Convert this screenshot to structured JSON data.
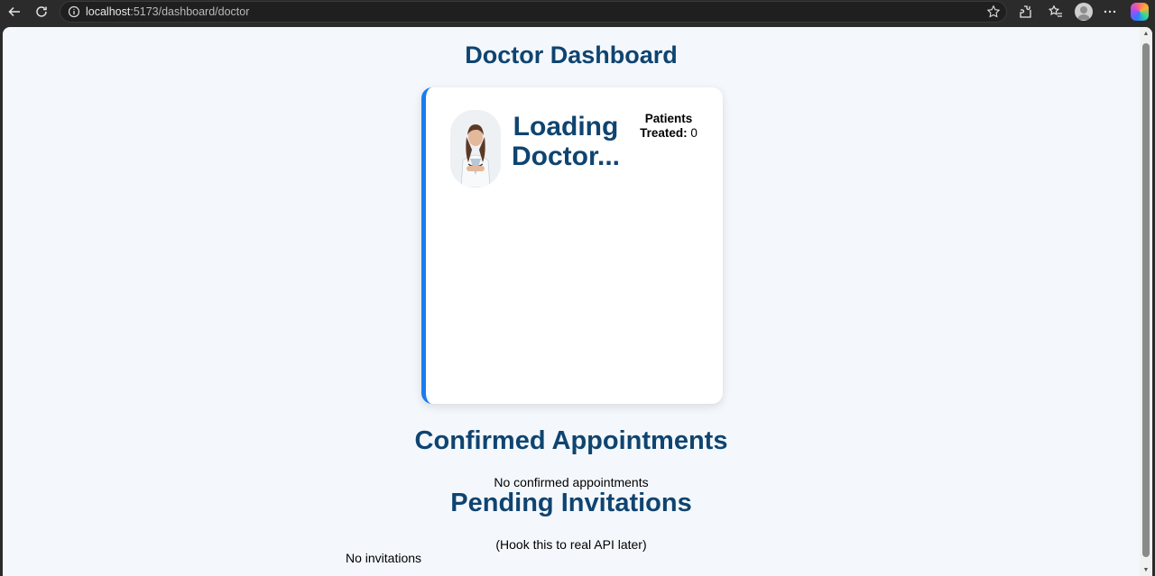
{
  "browser": {
    "url_host": "localhost",
    "url_rest": ":5173/dashboard/doctor"
  },
  "page": {
    "title": "Doctor Dashboard"
  },
  "doctor_card": {
    "name": "Loading Doctor...",
    "patients_label": "Patients Treated:",
    "patients_value": "0",
    "accent_color": "#1a7cf0"
  },
  "confirmed": {
    "title": "Confirmed Appointments",
    "empty_text": "No confirmed appointments"
  },
  "pending": {
    "title": "Pending Invitations",
    "note": "(Hook this to real API later)",
    "empty_text": "No invitations"
  },
  "colors": {
    "heading": "#0f4470",
    "background": "#f4f8fc"
  }
}
